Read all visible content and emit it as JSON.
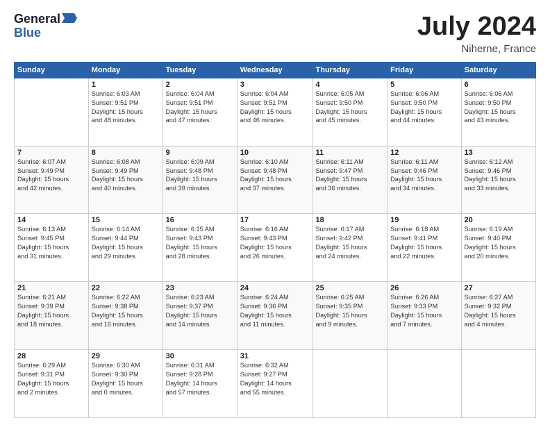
{
  "logo": {
    "general": "General",
    "blue": "Blue",
    "arrow": "▶"
  },
  "title": "July 2024",
  "location": "Niherne, France",
  "days_header": [
    "Sunday",
    "Monday",
    "Tuesday",
    "Wednesday",
    "Thursday",
    "Friday",
    "Saturday"
  ],
  "weeks": [
    [
      {
        "day": "",
        "info": ""
      },
      {
        "day": "1",
        "info": "Sunrise: 6:03 AM\nSunset: 9:51 PM\nDaylight: 15 hours\nand 48 minutes."
      },
      {
        "day": "2",
        "info": "Sunrise: 6:04 AM\nSunset: 9:51 PM\nDaylight: 15 hours\nand 47 minutes."
      },
      {
        "day": "3",
        "info": "Sunrise: 6:04 AM\nSunset: 9:51 PM\nDaylight: 15 hours\nand 46 minutes."
      },
      {
        "day": "4",
        "info": "Sunrise: 6:05 AM\nSunset: 9:50 PM\nDaylight: 15 hours\nand 45 minutes."
      },
      {
        "day": "5",
        "info": "Sunrise: 6:06 AM\nSunset: 9:50 PM\nDaylight: 15 hours\nand 44 minutes."
      },
      {
        "day": "6",
        "info": "Sunrise: 6:06 AM\nSunset: 9:50 PM\nDaylight: 15 hours\nand 43 minutes."
      }
    ],
    [
      {
        "day": "7",
        "info": "Sunrise: 6:07 AM\nSunset: 9:49 PM\nDaylight: 15 hours\nand 42 minutes."
      },
      {
        "day": "8",
        "info": "Sunrise: 6:08 AM\nSunset: 9:49 PM\nDaylight: 15 hours\nand 40 minutes."
      },
      {
        "day": "9",
        "info": "Sunrise: 6:09 AM\nSunset: 9:48 PM\nDaylight: 15 hours\nand 39 minutes."
      },
      {
        "day": "10",
        "info": "Sunrise: 6:10 AM\nSunset: 9:48 PM\nDaylight: 15 hours\nand 37 minutes."
      },
      {
        "day": "11",
        "info": "Sunrise: 6:11 AM\nSunset: 9:47 PM\nDaylight: 15 hours\nand 36 minutes."
      },
      {
        "day": "12",
        "info": "Sunrise: 6:11 AM\nSunset: 9:46 PM\nDaylight: 15 hours\nand 34 minutes."
      },
      {
        "day": "13",
        "info": "Sunrise: 6:12 AM\nSunset: 9:46 PM\nDaylight: 15 hours\nand 33 minutes."
      }
    ],
    [
      {
        "day": "14",
        "info": "Sunrise: 6:13 AM\nSunset: 9:45 PM\nDaylight: 15 hours\nand 31 minutes."
      },
      {
        "day": "15",
        "info": "Sunrise: 6:14 AM\nSunset: 9:44 PM\nDaylight: 15 hours\nand 29 minutes."
      },
      {
        "day": "16",
        "info": "Sunrise: 6:15 AM\nSunset: 9:43 PM\nDaylight: 15 hours\nand 28 minutes."
      },
      {
        "day": "17",
        "info": "Sunrise: 6:16 AM\nSunset: 9:43 PM\nDaylight: 15 hours\nand 26 minutes."
      },
      {
        "day": "18",
        "info": "Sunrise: 6:17 AM\nSunset: 9:42 PM\nDaylight: 15 hours\nand 24 minutes."
      },
      {
        "day": "19",
        "info": "Sunrise: 6:18 AM\nSunset: 9:41 PM\nDaylight: 15 hours\nand 22 minutes."
      },
      {
        "day": "20",
        "info": "Sunrise: 6:19 AM\nSunset: 9:40 PM\nDaylight: 15 hours\nand 20 minutes."
      }
    ],
    [
      {
        "day": "21",
        "info": "Sunrise: 6:21 AM\nSunset: 9:39 PM\nDaylight: 15 hours\nand 18 minutes."
      },
      {
        "day": "22",
        "info": "Sunrise: 6:22 AM\nSunset: 9:38 PM\nDaylight: 15 hours\nand 16 minutes."
      },
      {
        "day": "23",
        "info": "Sunrise: 6:23 AM\nSunset: 9:37 PM\nDaylight: 15 hours\nand 14 minutes."
      },
      {
        "day": "24",
        "info": "Sunrise: 6:24 AM\nSunset: 9:36 PM\nDaylight: 15 hours\nand 11 minutes."
      },
      {
        "day": "25",
        "info": "Sunrise: 6:25 AM\nSunset: 9:35 PM\nDaylight: 15 hours\nand 9 minutes."
      },
      {
        "day": "26",
        "info": "Sunrise: 6:26 AM\nSunset: 9:33 PM\nDaylight: 15 hours\nand 7 minutes."
      },
      {
        "day": "27",
        "info": "Sunrise: 6:27 AM\nSunset: 9:32 PM\nDaylight: 15 hours\nand 4 minutes."
      }
    ],
    [
      {
        "day": "28",
        "info": "Sunrise: 6:29 AM\nSunset: 9:31 PM\nDaylight: 15 hours\nand 2 minutes."
      },
      {
        "day": "29",
        "info": "Sunrise: 6:30 AM\nSunset: 9:30 PM\nDaylight: 15 hours\nand 0 minutes."
      },
      {
        "day": "30",
        "info": "Sunrise: 6:31 AM\nSunset: 9:28 PM\nDaylight: 14 hours\nand 57 minutes."
      },
      {
        "day": "31",
        "info": "Sunrise: 6:32 AM\nSunset: 9:27 PM\nDaylight: 14 hours\nand 55 minutes."
      },
      {
        "day": "",
        "info": ""
      },
      {
        "day": "",
        "info": ""
      },
      {
        "day": "",
        "info": ""
      }
    ]
  ]
}
